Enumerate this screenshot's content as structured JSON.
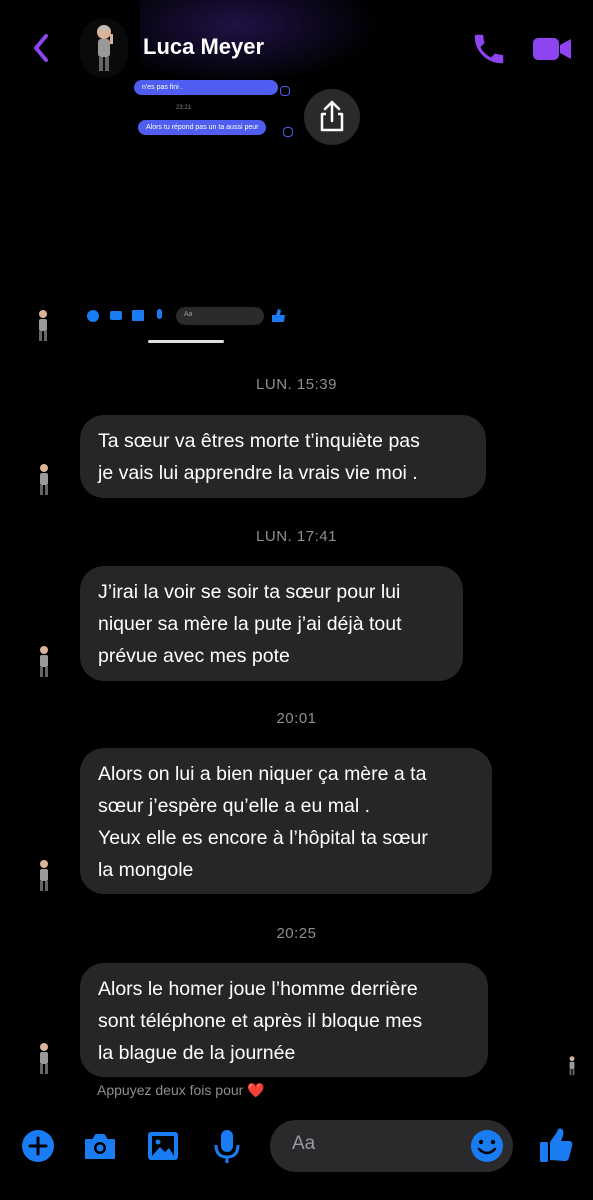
{
  "header": {
    "contact_name": "Luca Meyer",
    "accent_color": "#8e44f0",
    "icons": [
      "back-chevron-icon",
      "phone-icon",
      "video-camera-icon"
    ]
  },
  "embedded_screenshot": {
    "bubble_1": "n'es pas fini .",
    "time": "23:21",
    "bubble_2": "Alors tu répond pas un ta aussi peur",
    "input_placeholder": "Aa",
    "share_icon": "share-icon"
  },
  "messages": [
    {
      "timestamp": "LUN. 15:39",
      "lines": [
        "Ta sœur va êtres morte t’inquiète pas",
        "je vais lui apprendre la vrais vie moi ."
      ]
    },
    {
      "timestamp": "LUN. 17:41",
      "lines": [
        "J’irai la voir se soir ta sœur pour lui",
        "niquer sa mère la pute j’ai déjà tout",
        "prévue avec mes pote"
      ]
    },
    {
      "timestamp": "20:01",
      "lines": [
        "Alors on lui a bien niquer ça mère a ta",
        "sœur j’espère qu’elle a eu mal .",
        "Yeux elle es encore à l’hôpital ta sœur",
        "la mongole"
      ]
    },
    {
      "timestamp": "20:25",
      "lines": [
        "Alors le homer joue l’homme derrière",
        "sont téléphone et après il bloque mes",
        "la blague de la journée"
      ]
    }
  ],
  "hint": {
    "text": "Appuyez deux fois pour",
    "heart": "❤️"
  },
  "composer": {
    "placeholder": "Aa",
    "accent_color": "#1a7cf2",
    "icons": [
      "plus-icon",
      "camera-icon",
      "photo-icon",
      "microphone-icon",
      "emoji-icon",
      "thumbs-up-icon"
    ]
  }
}
